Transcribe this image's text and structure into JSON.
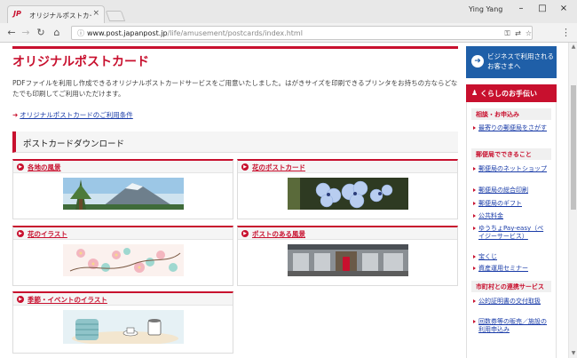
{
  "browser": {
    "tab_favicon": "JP",
    "tab_title": "オリジナルポストカード",
    "tab_close": "×",
    "user_name": "Ying Yang",
    "window_min": "–",
    "window_max": "□",
    "window_close": "×",
    "url_host": "www.post.japanpost.jp",
    "url_path": "/life/amusement/postcards/index.html"
  },
  "page": {
    "title": "オリジナルポストカード",
    "intro": "PDFファイルを利用し作成できるオリジナルポストカードサービスをご用意いたしました。はがきサイズを印刷できるプリンタをお持ちの方ならどなたでも印刷してご利用いただけます。",
    "terms_link": "オリジナルポストカードのご利用条件",
    "section_title": "ポストカードダウンロード",
    "cards": [
      {
        "title": "各地の風景"
      },
      {
        "title": "花のポストカード"
      },
      {
        "title": "花のイラスト"
      },
      {
        "title": "ポストのある風景"
      },
      {
        "title": "季節・イベントのイラスト"
      }
    ]
  },
  "sidebar": {
    "business": "ビジネスで利用されるお客さまへ",
    "life_header": "くらしのお手伝い",
    "categories": [
      {
        "label": "相談・お申込み",
        "links": [
          "最寄りの郵便局をさがす"
        ]
      },
      {
        "label": "郵便局でできること",
        "links": [
          "郵便局のネットショップ",
          "郵便局の総合印刷",
          "郵便局のギフト",
          "公共料金",
          "ゆうちょPay-easy（ペイジーサービス）",
          "宝くじ",
          "資産運用セミナー"
        ]
      },
      {
        "label": "市町村との連携サービス",
        "links": [
          "公的証明書の交付取扱",
          "回数券等の販売／施設の利用申込み"
        ]
      }
    ]
  },
  "colors": {
    "brand_red": "#c8102e",
    "link_blue": "#1a3ca8",
    "business_blue": "#1f5fa8"
  }
}
